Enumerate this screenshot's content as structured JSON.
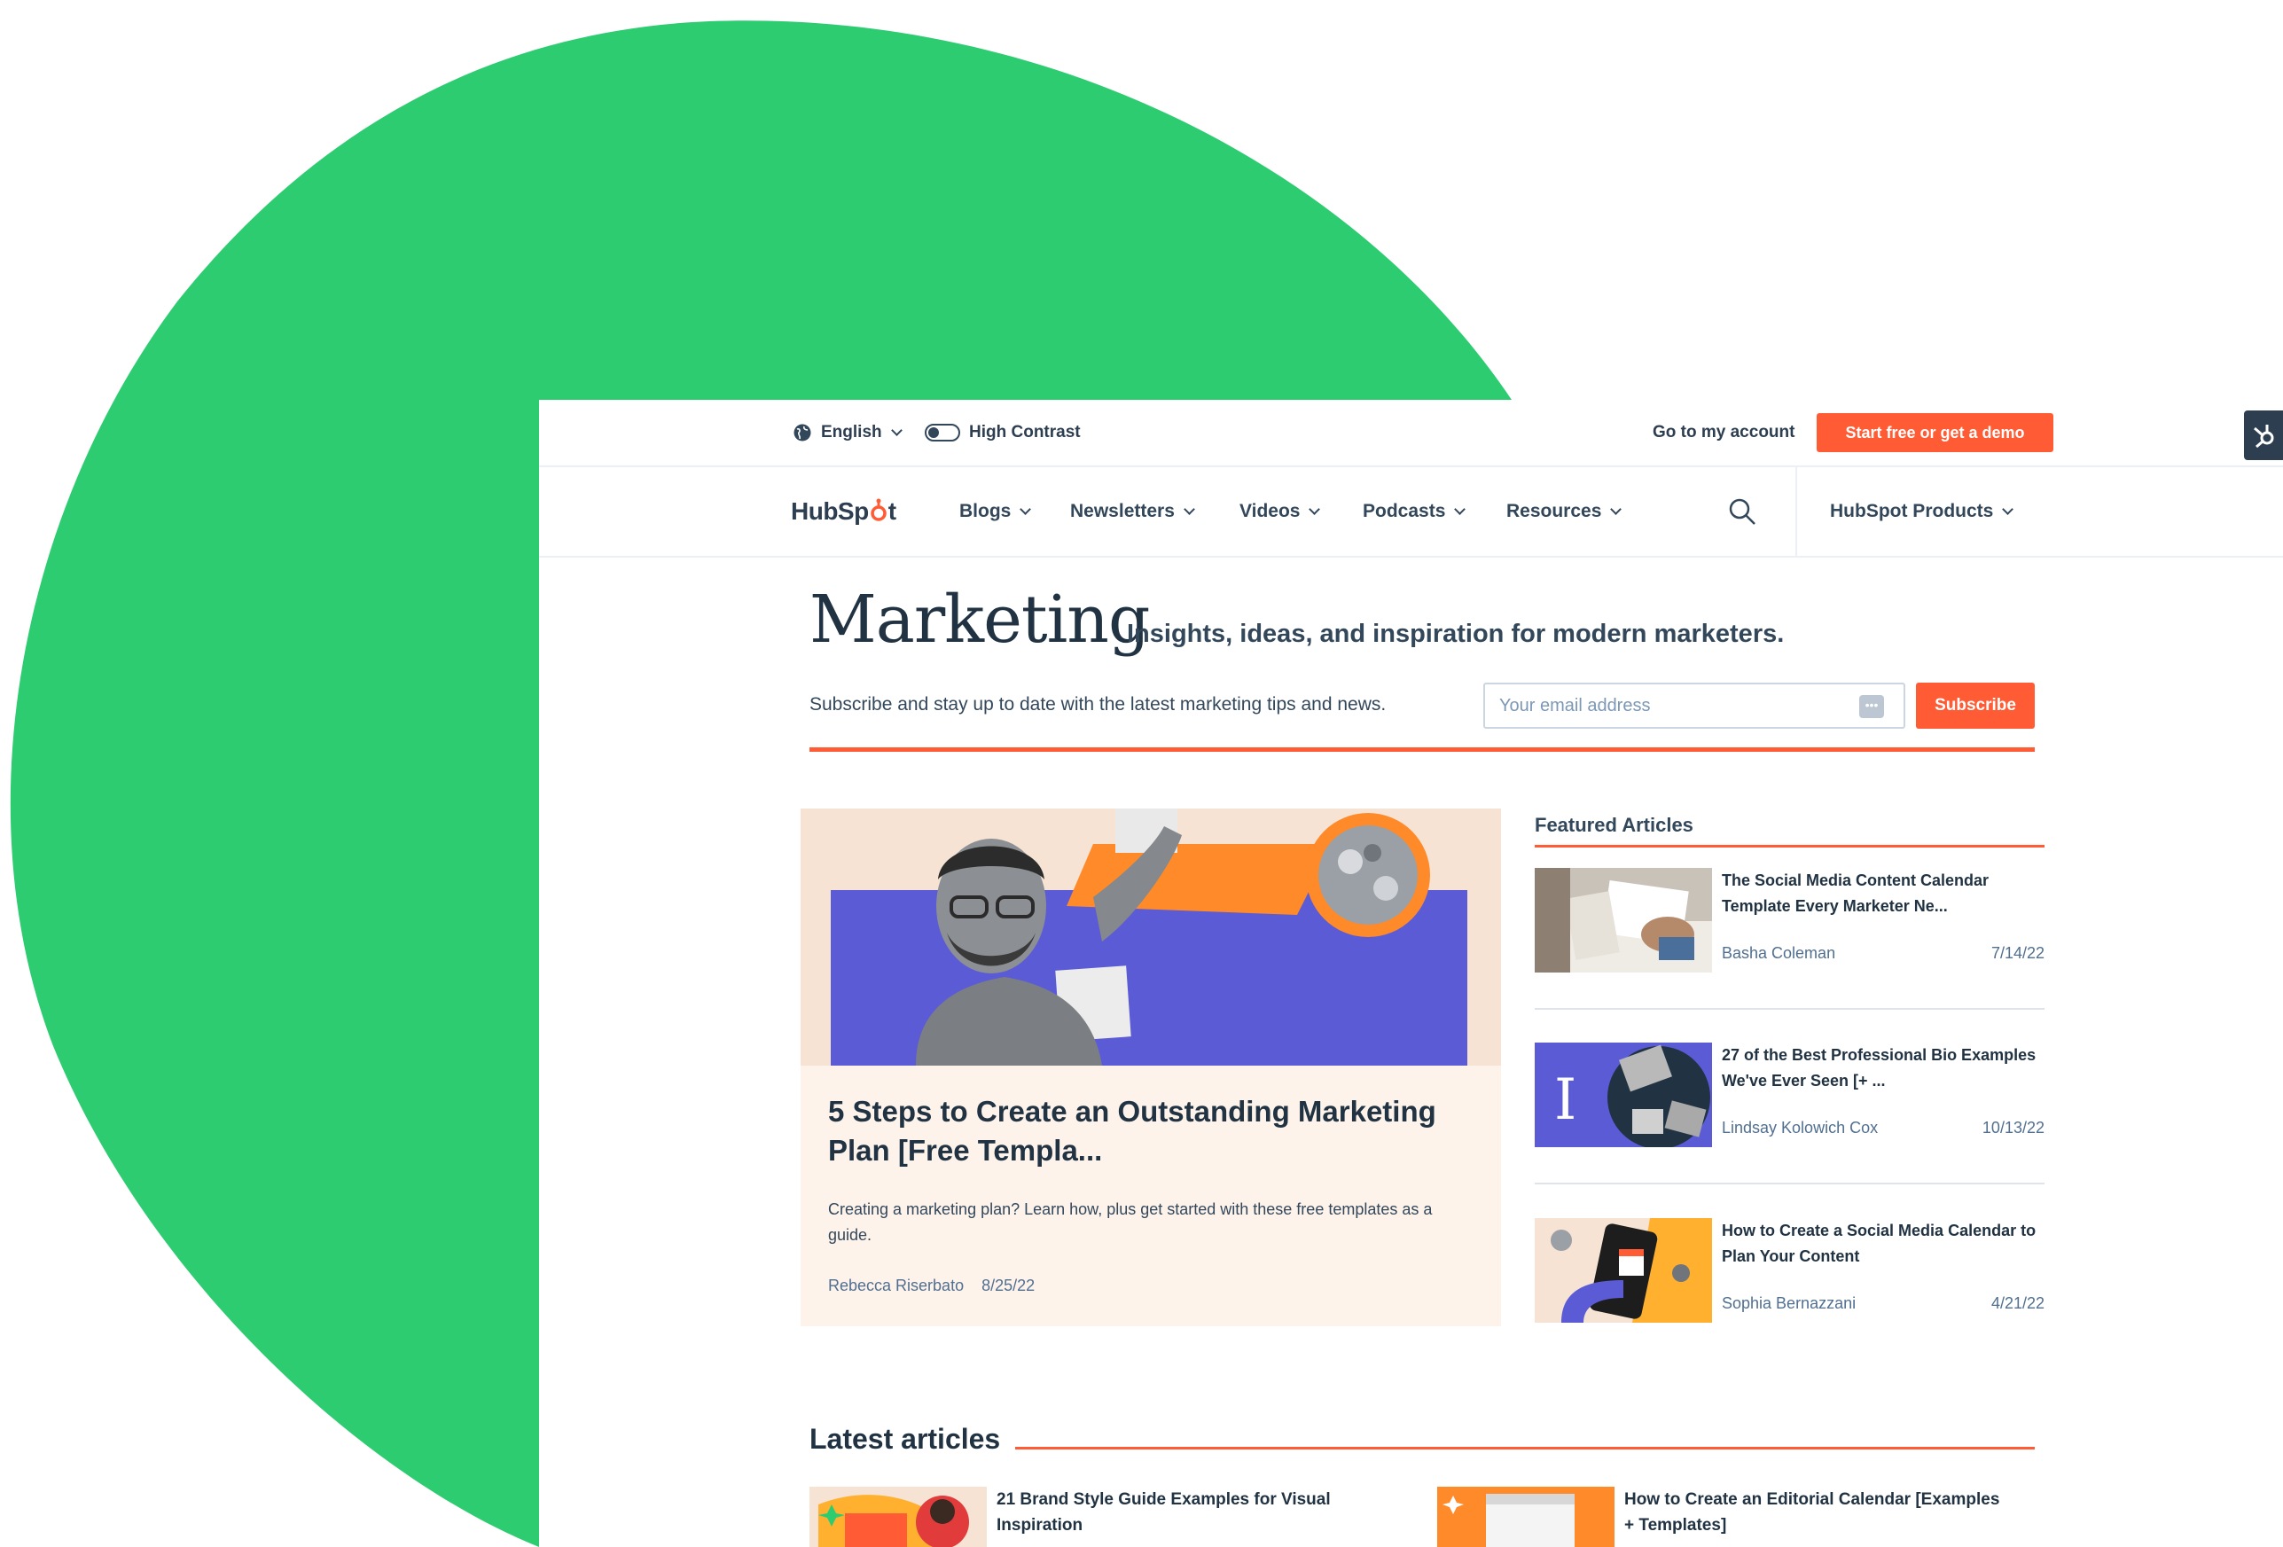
{
  "utility": {
    "language": "English",
    "contrast_label": "High Contrast",
    "account_link": "Go to my account",
    "cta_label": "Start free or get a demo"
  },
  "nav": {
    "logo_text_a": "HubSp",
    "logo_text_b": "t",
    "items": [
      "Blogs",
      "Newsletters",
      "Videos",
      "Podcasts",
      "Resources"
    ],
    "products_label": "HubSpot Products"
  },
  "hero": {
    "title": "Marketing",
    "subtitle": "Insights, ideas, and inspiration for modern marketers.",
    "subscribe_text": "Subscribe and stay up to date with the latest marketing tips and news.",
    "email_placeholder": "Your email address",
    "subscribe_label": "Subscribe"
  },
  "featured_main": {
    "title": "5 Steps to Create an Outstanding Marketing Plan [Free Templa...",
    "description": "Creating a marketing plan? Learn how, plus get started with these free templates as a guide.",
    "author": "Rebecca Riserbato",
    "date": "8/25/22"
  },
  "featured_articles": {
    "heading": "Featured Articles",
    "items": [
      {
        "title": "The Social Media Content Calendar Template Every Marketer Ne...",
        "author": "Basha Coleman",
        "date": "7/14/22"
      },
      {
        "title": "27 of the Best Professional Bio Examples We've Ever Seen [+ ...",
        "author": "Lindsay Kolowich Cox",
        "date": "10/13/22"
      },
      {
        "title": "How to Create a Social Media Calendar to Plan Your Content",
        "author": "Sophia Bernazzani",
        "date": "4/21/22"
      }
    ]
  },
  "latest": {
    "heading": "Latest articles",
    "items": [
      {
        "title": "21 Brand Style Guide Examples for Visual Inspiration"
      },
      {
        "title": "How to Create an Editorial Calendar [Examples + Templates]"
      }
    ]
  },
  "colors": {
    "brand_green": "#2ecc71",
    "accent_orange": "#ff5c35",
    "text_dark": "#213343",
    "purple": "#5b5bd6"
  }
}
